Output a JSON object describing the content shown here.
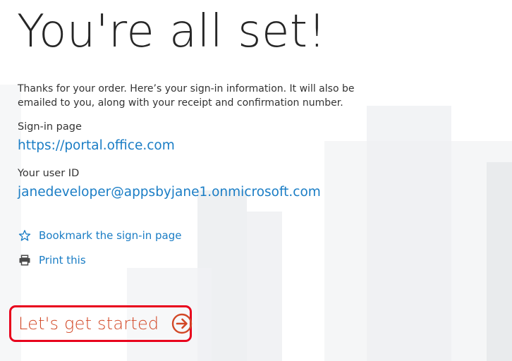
{
  "page": {
    "title": "You're all set!",
    "intro": "Thanks for your order. Here’s your sign-in information. It will also be emailed to you, along with your receipt and confirmation number."
  },
  "signin": {
    "label": "Sign-in page",
    "url": "https://portal.office.com"
  },
  "user": {
    "label": "Your user ID",
    "id": "janedeveloper@appsbyjane1.onmicrosoft.com"
  },
  "actions": {
    "bookmark_label": "Bookmark the sign-in page",
    "bookmark_icon": "star-outline-icon",
    "print_label": "Print this",
    "print_icon": "printer-icon"
  },
  "cta": {
    "label": "Let's get started",
    "icon": "arrow-circle-right-icon"
  },
  "colors": {
    "link": "#1a7dc5",
    "cta_text": "#d24726",
    "highlight_border": "#e8001c",
    "title": "#262626"
  }
}
